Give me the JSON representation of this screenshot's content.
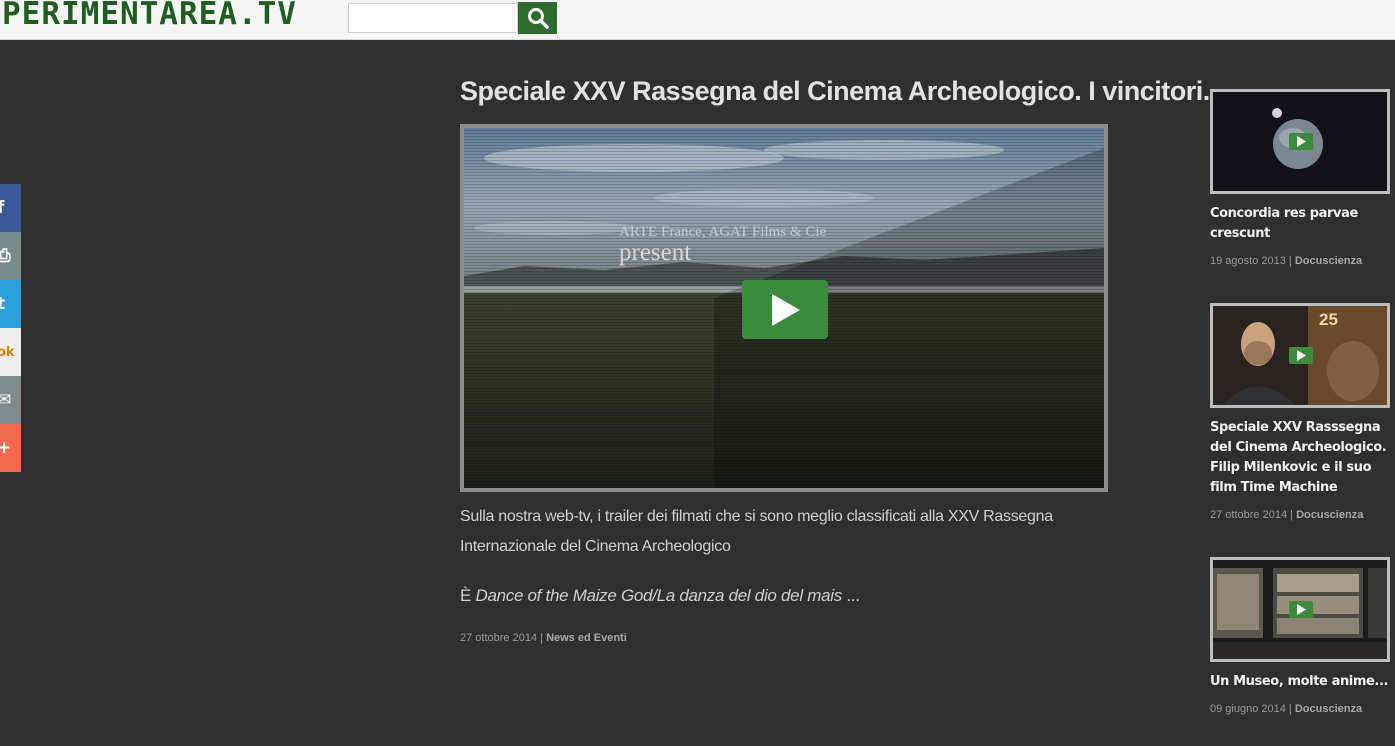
{
  "site": {
    "logo_text": "PERIMENTAREA.TV"
  },
  "search": {
    "placeholder": "",
    "value": "",
    "icon": "search-icon"
  },
  "share": {
    "items": [
      {
        "name": "facebook",
        "glyph": "f",
        "color": "#3b5998"
      },
      {
        "name": "print",
        "glyph": "⎙",
        "color": "#7a8b8c"
      },
      {
        "name": "twitter",
        "glyph": "t",
        "color": "#2aa0d8"
      },
      {
        "name": "ok",
        "glyph": "ok",
        "color": "#eeeeee"
      },
      {
        "name": "email",
        "glyph": "✉",
        "color": "#7f8c8d"
      },
      {
        "name": "more",
        "glyph": "+",
        "color": "#f26b4f"
      }
    ]
  },
  "article": {
    "title": "Speciale XXV Rassegna del Cinema Archeologico. I vincitori.",
    "video": {
      "caption_line1": "ARTE France, AGAT Films & Cie",
      "caption_line2": "present"
    },
    "body": "Sulla nostra web-tv, i trailer dei filmati che si sono meglio classificati alla XXV Rassegna Internazionale del Cinema Archeologico",
    "excerpt_prefix": "È ",
    "excerpt_italic": "Dance of the Maize God/La danza del dio del mais",
    "excerpt_suffix": " ...",
    "date": "27 ottobre 2014",
    "separator": " | ",
    "category": "News ed Eventi"
  },
  "sidebar": {
    "items": [
      {
        "title": "Concordia res parvae crescunt",
        "date": "19 agosto 2013",
        "category": "Docuscienza"
      },
      {
        "title": "Speciale XXV Rasssegna del Cinema Archeologico. Filip Milenkovic e il suo film Time Machine",
        "date": "27 ottobre 2014",
        "category": "Docuscienza"
      },
      {
        "title": "Un Museo, molte anime...",
        "date": "09 giugno 2014",
        "category": "Docuscienza"
      }
    ],
    "thumb_overlay_text": "25"
  },
  "colors": {
    "background": "#2f2f2f",
    "brand_green": "#1f5e1f",
    "play_green": "#3c8a3c"
  }
}
